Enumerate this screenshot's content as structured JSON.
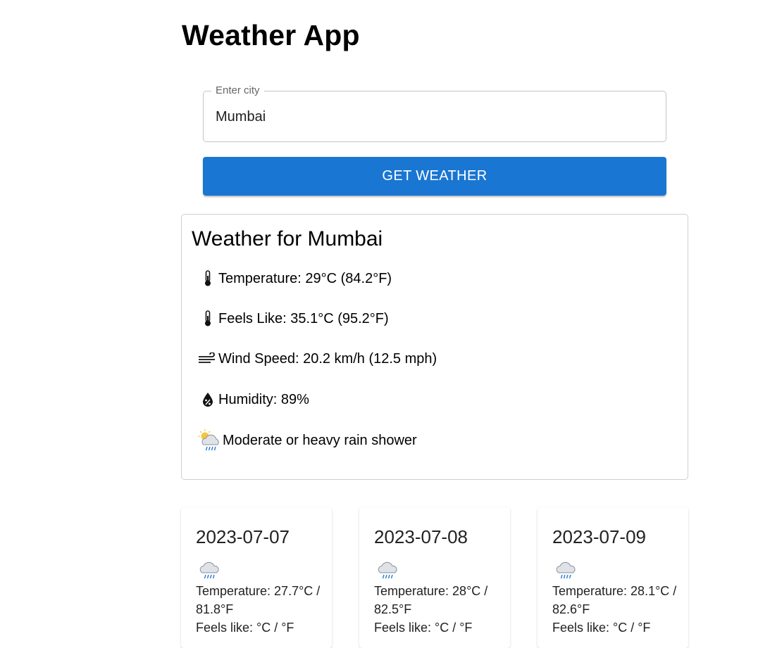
{
  "app": {
    "title": "Weather App"
  },
  "search": {
    "label": "Enter city",
    "value": "Mumbai",
    "button_label": "GET WEATHER"
  },
  "current": {
    "title": "Weather for Mumbai",
    "temperature": "Temperature: 29°C (84.2°F)",
    "feels_like": "Feels Like: 35.1°C (95.2°F)",
    "wind": "Wind Speed: 20.2 km/h (12.5 mph)",
    "humidity": "Humidity: 89%",
    "condition": "Moderate or heavy rain shower",
    "icons": {
      "temperature": "thermometer-icon",
      "feels_like": "thermometer-icon",
      "wind": "wind-icon",
      "humidity": "humidity-drop-icon",
      "condition": "sun-cloud-rain-icon"
    }
  },
  "forecast": [
    {
      "date": "2023-07-07",
      "temperature_line": "Temperature: 27.7°C / 81.8°F",
      "feels_like_line": "Feels like: °C / °F",
      "icon": "rain-cloud-icon"
    },
    {
      "date": "2023-07-08",
      "temperature_line": "Temperature: 28°C / 82.5°F",
      "feels_like_line": "Feels like: °C / °F",
      "icon": "rain-cloud-icon"
    },
    {
      "date": "2023-07-09",
      "temperature_line": "Temperature: 28.1°C / 82.6°F",
      "feels_like_line": "Feels like: °C / °F",
      "icon": "rain-cloud-icon"
    }
  ],
  "colors": {
    "primary": "#1976d2",
    "border": "#c4c4c4"
  }
}
